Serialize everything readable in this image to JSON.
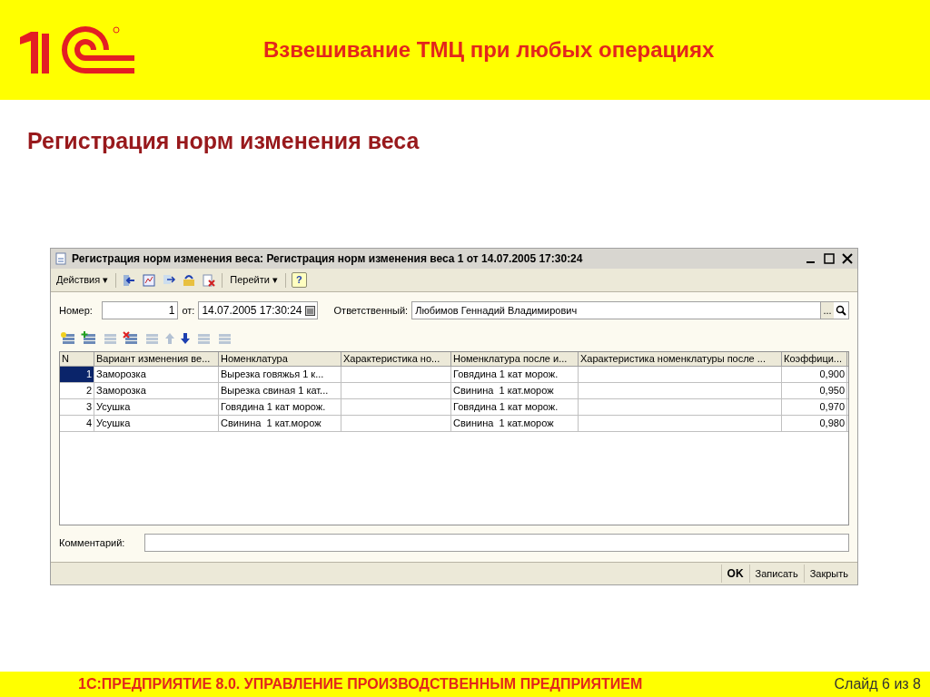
{
  "slide": {
    "title": "Взвешивание ТМЦ при любых операциях",
    "heading": "Регистрация норм изменения веса"
  },
  "window": {
    "title": "Регистрация норм изменения веса: Регистрация норм изменения веса 1 от 14.07.2005 17:30:24",
    "menus": [
      {
        "label": "Действия",
        "caret": "▾"
      },
      {
        "label": "Перейти",
        "caret": "▾"
      }
    ],
    "help": "?",
    "fields": {
      "number_label": "Номер:",
      "number": "1",
      "date_label": "от:",
      "date": "14.07.2005 17:30:24",
      "responsible_label": "Ответственный:",
      "responsible": "Любимов Геннадий Владимирович",
      "select_button": "..."
    },
    "table": {
      "columns": [
        "N",
        "Вариант изменения ве...",
        "Номенклатура",
        "Характеристика но...",
        "Номенклатура после и...",
        "Характеристика номенклатуры после ...",
        "Коэффици..."
      ],
      "rows": [
        {
          "n": "1",
          "variant": "Заморозка",
          "item": "Вырезка говяжья 1 к...",
          "item_after": "Говядина 1 кат морож.",
          "coefficient": "0,900",
          "selected": true
        },
        {
          "n": "2",
          "variant": "Заморозка",
          "item": "Вырезка свиная 1 кат...",
          "item_after": "Свинина  1 кат.морож",
          "coefficient": "0,950",
          "selected": false
        },
        {
          "n": "3",
          "variant": "Усушка",
          "item": "Говядина 1 кат морож.",
          "item_after": "Говядина 1 кат морож.",
          "coefficient": "0,970",
          "selected": false
        },
        {
          "n": "4",
          "variant": "Усушка",
          "item": "Свинина  1 кат.морож",
          "item_after": "Свинина  1 кат.морож",
          "coefficient": "0,980",
          "selected": false
        }
      ]
    },
    "comment_label": "Комментарий:",
    "buttons": [
      {
        "label": "OK",
        "kind": "default"
      },
      {
        "label": "Записать",
        "kind": "normal"
      },
      {
        "label": "Закрыть",
        "kind": "normal"
      }
    ]
  },
  "footer": {
    "product": "1С:ПРЕДПРИЯТИЕ 8.0. УПРАВЛЕНИЕ ПРОИЗВОДСТВЕННЫМ ПРЕДПРИЯТИЕМ",
    "page": "Слайд 6 из 8"
  }
}
